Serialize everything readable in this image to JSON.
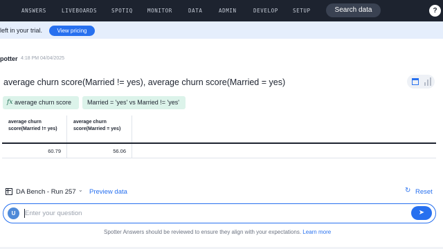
{
  "nav": {
    "items": [
      "ANSWERS",
      "LIVEBOARDS",
      "SPOTIQ",
      "MONITOR",
      "DATA",
      "ADMIN",
      "DEVELOP",
      "SETUP"
    ],
    "search_label": "Search data",
    "help_icon": "?"
  },
  "banner": {
    "text": "left in your trial.",
    "pricing_label": "View pricing"
  },
  "spotter": {
    "name": "potter",
    "timestamp": "4:18 PM 04/04/2025"
  },
  "answer": {
    "title": "average churn score(Married != yes), average churn score(Married = yes)",
    "view_toggle": {
      "active": "table-icon",
      "inactive": "chart-icon"
    },
    "chips": {
      "formula_icon": "fx",
      "formula": "average churn score",
      "filter": "Married = 'yes' vs Married != 'yes'"
    },
    "table": {
      "headers": [
        "average churn score(Married != yes)",
        "average churn score(Married = yes)"
      ],
      "rows": [
        [
          "60.79",
          "56.06"
        ]
      ]
    }
  },
  "context": {
    "dataset": "DA Bench - Run 257",
    "preview_label": "Preview data",
    "reset_label": "Reset"
  },
  "input": {
    "avatar": "U",
    "placeholder": "Enter your question",
    "send_icon": "send-icon"
  },
  "footer": {
    "disclaimer": "Spotter Answers should be reviewed to ensure they align with your expectations.",
    "learn_more": "Learn more"
  },
  "colors": {
    "nav_bg": "#1d232f",
    "accent": "#2770ef",
    "banner_bg": "#e5eefc",
    "chip_bg": "#dcf3ea"
  }
}
